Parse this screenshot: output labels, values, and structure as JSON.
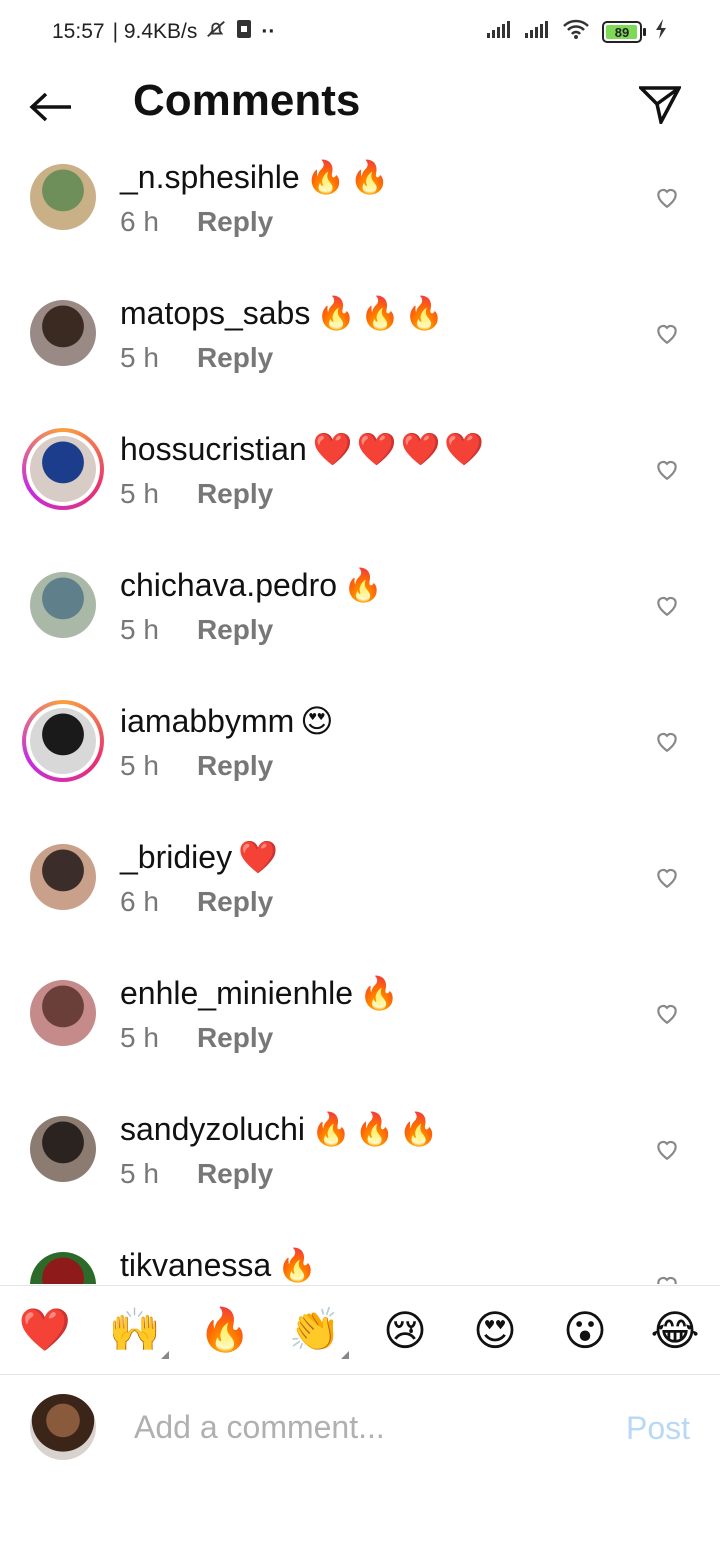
{
  "status_bar": {
    "time": "15:57",
    "network_speed": "| 9.4KB/s",
    "battery": "89",
    "icons": [
      "mute-bell-icon",
      "sim-icon",
      "more-dots-icon",
      "signal-icon",
      "signal-icon",
      "wifi-icon",
      "battery-icon",
      "charging-icon"
    ]
  },
  "header": {
    "title": "Comments",
    "back_icon": "arrow-left-icon",
    "send_icon": "paper-plane-icon"
  },
  "comments": [
    {
      "username": "_n.sphesihle",
      "emoji": "🔥🔥",
      "time": "6 h",
      "reply": "Reply",
      "story_ring": false,
      "avatar_colors": [
        "#6f8f5a",
        "#c9b087"
      ]
    },
    {
      "username": "matops_sabs",
      "emoji": "🔥🔥🔥",
      "time": "5 h",
      "reply": "Reply",
      "story_ring": false,
      "avatar_colors": [
        "#3b2a22",
        "#9a8a86"
      ]
    },
    {
      "username": "hossucristian",
      "emoji": "❤️❤️❤️❤️",
      "time": "5 h",
      "reply": "Reply",
      "story_ring": true,
      "avatar_colors": [
        "#1c3c8c",
        "#d7cdc6"
      ]
    },
    {
      "username": "chichava.pedro",
      "emoji": "🔥",
      "time": "5 h",
      "reply": "Reply",
      "story_ring": false,
      "avatar_colors": [
        "#5f7f8a",
        "#aab8a8"
      ]
    },
    {
      "username": "iamabbymm",
      "emoji": "😍",
      "time": "5 h",
      "reply": "Reply",
      "story_ring": true,
      "avatar_colors": [
        "#1a1a1a",
        "#d8d8d8"
      ]
    },
    {
      "username": "_bridiey",
      "emoji": "❤️",
      "time": "6 h",
      "reply": "Reply",
      "story_ring": false,
      "avatar_colors": [
        "#3a2d2a",
        "#c9a18a"
      ]
    },
    {
      "username": "enhle_minienhle",
      "emoji": "🔥",
      "time": "5 h",
      "reply": "Reply",
      "story_ring": false,
      "avatar_colors": [
        "#6b3f39",
        "#c58a8a"
      ]
    },
    {
      "username": "sandyzoluchi",
      "emoji": "🔥🔥🔥",
      "time": "5 h",
      "reply": "Reply",
      "story_ring": false,
      "avatar_colors": [
        "#2b2320",
        "#8c7b70"
      ]
    },
    {
      "username": "tikvanessa",
      "emoji": "🔥",
      "time": "",
      "reply": "",
      "story_ring": false,
      "avatar_colors": [
        "#8e1a1a",
        "#2c6a2a"
      ]
    }
  ],
  "reactions": [
    {
      "emoji": "❤️",
      "name": "red-heart-emoji",
      "has_variants": false
    },
    {
      "emoji": "🙌",
      "name": "raising-hands-emoji",
      "has_variants": true
    },
    {
      "emoji": "🔥",
      "name": "fire-emoji",
      "has_variants": false
    },
    {
      "emoji": "👏",
      "name": "clapping-hands-emoji",
      "has_variants": true
    },
    {
      "emoji": "😢",
      "name": "crying-face-emoji",
      "has_variants": false
    },
    {
      "emoji": "😍",
      "name": "heart-eyes-emoji",
      "has_variants": false
    },
    {
      "emoji": "😮",
      "name": "surprised-face-emoji",
      "has_variants": false
    },
    {
      "emoji": "😂",
      "name": "tears-of-joy-emoji",
      "has_variants": false
    }
  ],
  "composer": {
    "placeholder": "Add a comment...",
    "post_label": "Post"
  }
}
